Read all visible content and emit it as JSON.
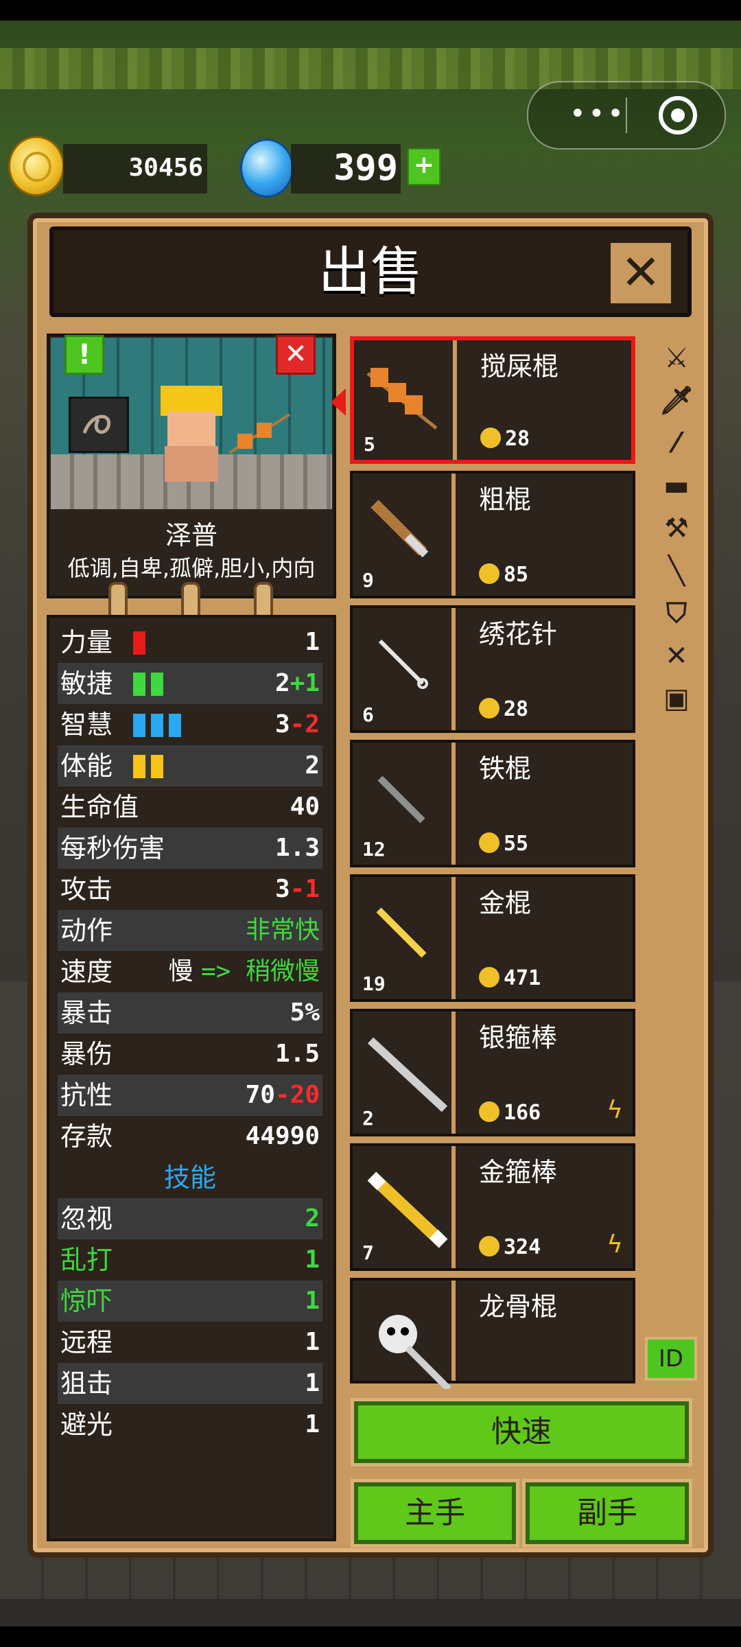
{
  "hud": {
    "coins": "30456",
    "gems": "399",
    "plus": "+"
  },
  "dialog": {
    "title": "出售"
  },
  "hero": {
    "name": "泽普",
    "traits": "低调,自卑,孤僻,胆小,内向",
    "warn": "!",
    "remove": "✕"
  },
  "stats": [
    {
      "label": "力量",
      "value": "1",
      "bars": 1,
      "bar_color": "#e81b1b"
    },
    {
      "label": "敏捷",
      "value": "2",
      "mod": "+1",
      "mod_color": "green",
      "bars": 2,
      "bar_color": "#3ed93e"
    },
    {
      "label": "智慧",
      "value": "3",
      "mod": "-2",
      "mod_color": "red",
      "bars": 3,
      "bar_color": "#2aa8f0"
    },
    {
      "label": "体能",
      "value": "2",
      "bars": 2,
      "bar_color": "#f5c518"
    },
    {
      "label": "生命值",
      "value": "40"
    },
    {
      "label": "每秒伤害",
      "value": "1.3"
    },
    {
      "label": "攻击",
      "value": "3",
      "mod": "-1",
      "mod_color": "red"
    },
    {
      "label": "动作",
      "value": "非常快",
      "value_color": "green"
    },
    {
      "label": "速度",
      "value_pre": "慢",
      "arrow": "=>",
      "value": "稍微慢"
    },
    {
      "label": "暴击",
      "value": "5%"
    },
    {
      "label": "暴伤",
      "value": "1.5"
    },
    {
      "label": "抗性",
      "value": "70",
      "mod": "-20",
      "mod_color": "red"
    },
    {
      "label": "存款",
      "value": "44990"
    }
  ],
  "skills_title": "技能",
  "skills": [
    {
      "label": "忽视",
      "value": "2",
      "highlight": false,
      "value_green": true
    },
    {
      "label": "乱打",
      "value": "1",
      "highlight": true
    },
    {
      "label": "惊吓",
      "value": "1",
      "highlight": true
    },
    {
      "label": "远程",
      "value": "1",
      "highlight": false
    },
    {
      "label": "狙击",
      "value": "1",
      "highlight": false
    },
    {
      "label": "避光",
      "value": "1",
      "highlight": false
    }
  ],
  "items": [
    {
      "name": "搅屎棍",
      "count": "5",
      "price": "28",
      "icon": "skewer-icon",
      "selected": true
    },
    {
      "name": "粗棍",
      "count": "9",
      "price": "85",
      "icon": "club-icon"
    },
    {
      "name": "绣花针",
      "count": "6",
      "price": "28",
      "icon": "needle-icon"
    },
    {
      "name": "铁棍",
      "count": "12",
      "price": "55",
      "icon": "iron-rod-icon"
    },
    {
      "name": "金棍",
      "count": "19",
      "price": "471",
      "icon": "gold-rod-icon"
    },
    {
      "name": "银箍棒",
      "count": "2",
      "price": "166",
      "icon": "silver-staff-icon",
      "bonus": true
    },
    {
      "name": "金箍棒",
      "count": "7",
      "price": "324",
      "icon": "golden-staff-icon",
      "bonus": true
    },
    {
      "name": "龙骨棍",
      "count": "",
      "price": "",
      "icon": "dragon-bone-icon"
    }
  ],
  "categories": [
    "crossed-swords-icon",
    "knife-icon",
    "sword-icon",
    "gun-icon",
    "axe-icon",
    "staff-icon",
    "shield-icon",
    "bow-icon",
    "armor-icon"
  ],
  "buttons": {
    "id": "ID",
    "quick": "快速",
    "main_hand": "主手",
    "off_hand": "副手"
  }
}
